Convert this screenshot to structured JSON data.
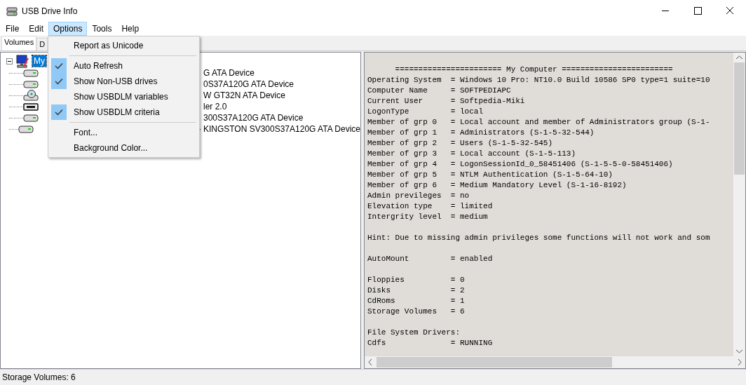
{
  "window": {
    "title": "USB Drive Info"
  },
  "menu_bar": [
    {
      "label": "File",
      "selected": false
    },
    {
      "label": "Edit",
      "selected": false
    },
    {
      "label": "Options",
      "selected": true
    },
    {
      "label": "Tools",
      "selected": false
    },
    {
      "label": "Help",
      "selected": false
    }
  ],
  "tabs": [
    {
      "label": "Volumes",
      "selected": true
    },
    {
      "label": "D",
      "selected": false
    }
  ],
  "options_menu": [
    {
      "kind": "item",
      "label": "Report as Unicode",
      "checked": false
    },
    {
      "kind": "separator"
    },
    {
      "kind": "item",
      "label": "Auto Refresh",
      "checked": true
    },
    {
      "kind": "item",
      "label": "Show Non-USB drives",
      "checked": true
    },
    {
      "kind": "item",
      "label": "Show USBDLM variables",
      "checked": false
    },
    {
      "kind": "item",
      "label": "Show USBDLM criteria",
      "checked": true
    },
    {
      "kind": "separator"
    },
    {
      "kind": "item",
      "label": "Font...",
      "checked": false
    },
    {
      "kind": "item",
      "label": "Background Color...",
      "checked": false
    }
  ],
  "tree": {
    "label": "My",
    "selected": true,
    "expanded": true,
    "children": [
      {
        "kind": "disk",
        "label": "G ATA Device"
      },
      {
        "kind": "disk",
        "label": "0S37A120G ATA Device"
      },
      {
        "kind": "cdrom",
        "label": "W GT32N ATA Device"
      },
      {
        "kind": "usb",
        "label": "ler 2.0"
      },
      {
        "kind": "disk",
        "label": "300S37A120G ATA Device"
      },
      {
        "kind": "disk",
        "label": "- KINGSTON SV300S37A120G ATA Device"
      }
    ]
  },
  "report_sections": [
    [
      "      ======================= My Computer ========================",
      "Operating System  = Windows 10 Pro: NT10.0 Build 10586 SP0 type=1 suite=10",
      "Computer Name     = SOFTPEDIAPC",
      "Current User      = Softpedia-Miki",
      "LogonType         = local",
      "Member of grp 0   = Local account and member of Administrators group (S-1-",
      "Member of grp 1   = Administrators (S-1-5-32-544)",
      "Member of grp 2   = Users (S-1-5-32-545)",
      "Member of grp 3   = Local account (S-1-5-113)",
      "Member of grp 4   = LogonSessionId_0_58451406 (S-1-5-5-0-58451406)",
      "Member of grp 5   = NTLM Authentication (S-1-5-64-10)",
      "Member of grp 6   = Medium Mandatory Level (S-1-16-8192)",
      "Admin previleges  = no",
      "Elevation type    = limited",
      "Intergrity level  = medium"
    ],
    [
      "Hint: Due to missing admin privileges some functions will not work and som"
    ],
    [
      "AutoMount         = enabled"
    ],
    [
      "Floppies          = 0",
      "Disks             = 2",
      "CdRoms            = 1",
      "Storage Volumes   = 6"
    ],
    [
      "File System Drivers:",
      "Cdfs              = RUNNING"
    ]
  ],
  "status_bar": "Storage Volumes: 6"
}
